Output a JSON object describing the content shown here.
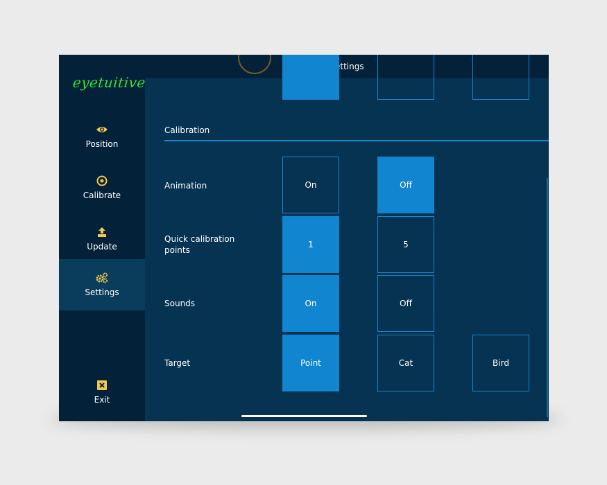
{
  "app": {
    "logo_text": "eyetuitive",
    "title": "Settings"
  },
  "sidebar": {
    "items": [
      {
        "label": "Position",
        "icon": "eye-icon"
      },
      {
        "label": "Calibrate",
        "icon": "target-icon"
      },
      {
        "label": "Update",
        "icon": "upload-icon",
        "active": false
      },
      {
        "label": "Settings",
        "icon": "gears-icon",
        "active": true
      },
      {
        "label": "Exit",
        "icon": "close-icon"
      }
    ]
  },
  "section": {
    "title": "Calibration"
  },
  "settings": [
    {
      "label": "Animation",
      "options": [
        "On",
        "Off"
      ],
      "selected": "Off"
    },
    {
      "label": "Quick calibration points",
      "options": [
        "1",
        "5"
      ],
      "selected": "1"
    },
    {
      "label": "Sounds",
      "options": [
        "On",
        "Off"
      ],
      "selected": "On"
    },
    {
      "label": "Target",
      "options": [
        "Point",
        "Cat",
        "Bird"
      ],
      "selected": "Point"
    }
  ],
  "colors": {
    "accent": "#1185d0",
    "background": "#063352",
    "sidebar": "#03223a",
    "logo": "#34e234",
    "icon": "#f2c94c"
  }
}
